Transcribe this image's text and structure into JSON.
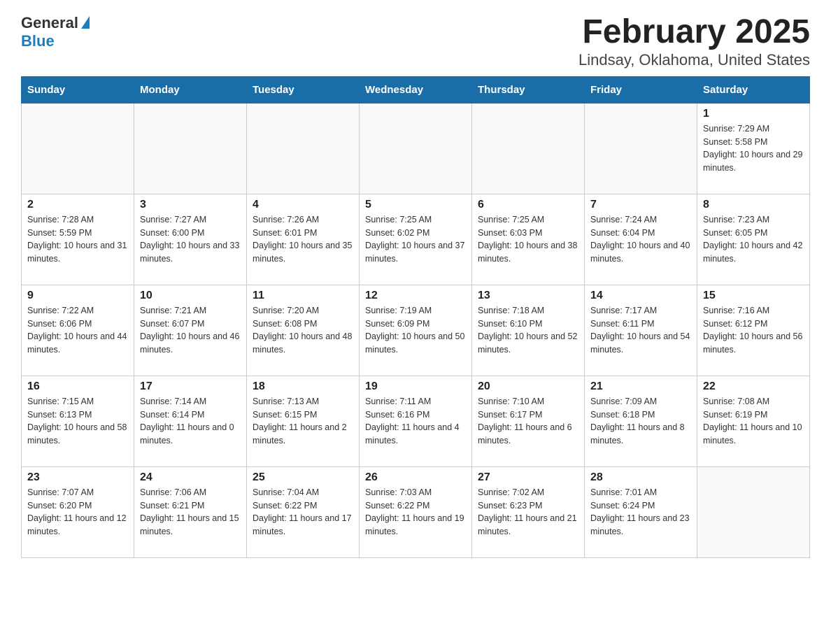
{
  "logo": {
    "general": "General",
    "blue": "Blue"
  },
  "title": "February 2025",
  "subtitle": "Lindsay, Oklahoma, United States",
  "days_of_week": [
    "Sunday",
    "Monday",
    "Tuesday",
    "Wednesday",
    "Thursday",
    "Friday",
    "Saturday"
  ],
  "weeks": [
    [
      {
        "day": "",
        "info": ""
      },
      {
        "day": "",
        "info": ""
      },
      {
        "day": "",
        "info": ""
      },
      {
        "day": "",
        "info": ""
      },
      {
        "day": "",
        "info": ""
      },
      {
        "day": "",
        "info": ""
      },
      {
        "day": "1",
        "info": "Sunrise: 7:29 AM\nSunset: 5:58 PM\nDaylight: 10 hours and 29 minutes."
      }
    ],
    [
      {
        "day": "2",
        "info": "Sunrise: 7:28 AM\nSunset: 5:59 PM\nDaylight: 10 hours and 31 minutes."
      },
      {
        "day": "3",
        "info": "Sunrise: 7:27 AM\nSunset: 6:00 PM\nDaylight: 10 hours and 33 minutes."
      },
      {
        "day": "4",
        "info": "Sunrise: 7:26 AM\nSunset: 6:01 PM\nDaylight: 10 hours and 35 minutes."
      },
      {
        "day": "5",
        "info": "Sunrise: 7:25 AM\nSunset: 6:02 PM\nDaylight: 10 hours and 37 minutes."
      },
      {
        "day": "6",
        "info": "Sunrise: 7:25 AM\nSunset: 6:03 PM\nDaylight: 10 hours and 38 minutes."
      },
      {
        "day": "7",
        "info": "Sunrise: 7:24 AM\nSunset: 6:04 PM\nDaylight: 10 hours and 40 minutes."
      },
      {
        "day": "8",
        "info": "Sunrise: 7:23 AM\nSunset: 6:05 PM\nDaylight: 10 hours and 42 minutes."
      }
    ],
    [
      {
        "day": "9",
        "info": "Sunrise: 7:22 AM\nSunset: 6:06 PM\nDaylight: 10 hours and 44 minutes."
      },
      {
        "day": "10",
        "info": "Sunrise: 7:21 AM\nSunset: 6:07 PM\nDaylight: 10 hours and 46 minutes."
      },
      {
        "day": "11",
        "info": "Sunrise: 7:20 AM\nSunset: 6:08 PM\nDaylight: 10 hours and 48 minutes."
      },
      {
        "day": "12",
        "info": "Sunrise: 7:19 AM\nSunset: 6:09 PM\nDaylight: 10 hours and 50 minutes."
      },
      {
        "day": "13",
        "info": "Sunrise: 7:18 AM\nSunset: 6:10 PM\nDaylight: 10 hours and 52 minutes."
      },
      {
        "day": "14",
        "info": "Sunrise: 7:17 AM\nSunset: 6:11 PM\nDaylight: 10 hours and 54 minutes."
      },
      {
        "day": "15",
        "info": "Sunrise: 7:16 AM\nSunset: 6:12 PM\nDaylight: 10 hours and 56 minutes."
      }
    ],
    [
      {
        "day": "16",
        "info": "Sunrise: 7:15 AM\nSunset: 6:13 PM\nDaylight: 10 hours and 58 minutes."
      },
      {
        "day": "17",
        "info": "Sunrise: 7:14 AM\nSunset: 6:14 PM\nDaylight: 11 hours and 0 minutes."
      },
      {
        "day": "18",
        "info": "Sunrise: 7:13 AM\nSunset: 6:15 PM\nDaylight: 11 hours and 2 minutes."
      },
      {
        "day": "19",
        "info": "Sunrise: 7:11 AM\nSunset: 6:16 PM\nDaylight: 11 hours and 4 minutes."
      },
      {
        "day": "20",
        "info": "Sunrise: 7:10 AM\nSunset: 6:17 PM\nDaylight: 11 hours and 6 minutes."
      },
      {
        "day": "21",
        "info": "Sunrise: 7:09 AM\nSunset: 6:18 PM\nDaylight: 11 hours and 8 minutes."
      },
      {
        "day": "22",
        "info": "Sunrise: 7:08 AM\nSunset: 6:19 PM\nDaylight: 11 hours and 10 minutes."
      }
    ],
    [
      {
        "day": "23",
        "info": "Sunrise: 7:07 AM\nSunset: 6:20 PM\nDaylight: 11 hours and 12 minutes."
      },
      {
        "day": "24",
        "info": "Sunrise: 7:06 AM\nSunset: 6:21 PM\nDaylight: 11 hours and 15 minutes."
      },
      {
        "day": "25",
        "info": "Sunrise: 7:04 AM\nSunset: 6:22 PM\nDaylight: 11 hours and 17 minutes."
      },
      {
        "day": "26",
        "info": "Sunrise: 7:03 AM\nSunset: 6:22 PM\nDaylight: 11 hours and 19 minutes."
      },
      {
        "day": "27",
        "info": "Sunrise: 7:02 AM\nSunset: 6:23 PM\nDaylight: 11 hours and 21 minutes."
      },
      {
        "day": "28",
        "info": "Sunrise: 7:01 AM\nSunset: 6:24 PM\nDaylight: 11 hours and 23 minutes."
      },
      {
        "day": "",
        "info": ""
      }
    ]
  ]
}
